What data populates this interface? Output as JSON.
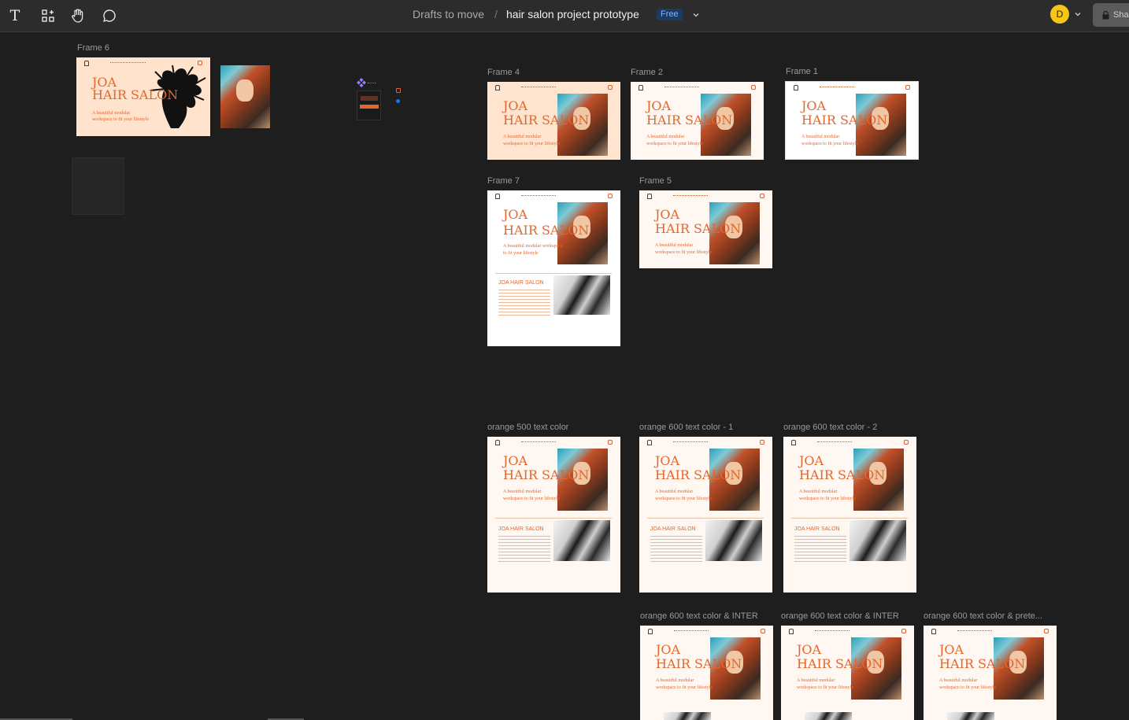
{
  "toolbar": {
    "tools": [
      {
        "name": "text-tool",
        "glyph": "T"
      },
      {
        "name": "components-tool",
        "glyph": "⊹"
      },
      {
        "name": "hand-tool",
        "glyph": "✋"
      },
      {
        "name": "comment-tool",
        "glyph": "💬"
      }
    ],
    "breadcrumb_parent": "Drafts to move",
    "breadcrumb_sep": "/",
    "file_name": "hair salon project prototype",
    "plan_badge": "Free",
    "avatar_initial": "D",
    "share_label": "Share"
  },
  "colors": {
    "accent_orange": "#e3672d",
    "canvas_bg": "#1e1e1e",
    "toolbar_bg": "#2c2c2c",
    "badge_blue": "#1d3a63",
    "avatar_yellow": "#f5c518"
  },
  "frames": [
    {
      "label": "Frame 6",
      "title1": "JOA",
      "title2": "HAIR SALON",
      "sub1": "A beautiful modular",
      "sub2": "workspace to fit your lifestyle"
    },
    {
      "label": "Frame 4",
      "title1": "JOA",
      "title2": "HAIR SALON",
      "sub1": "A beautiful modular",
      "sub2": "workspace to fit your lifestyle"
    },
    {
      "label": "Frame 2",
      "title1": "JOA",
      "title2": "HAIR SALON",
      "sub1": "A beautiful modular",
      "sub2": "workspace to fit your lifestyle"
    },
    {
      "label": "Frame 1",
      "title1": "JOA",
      "title2": "HAIR SALON",
      "sub1": "A beautiful modular",
      "sub2": "workspace to fit your lifestyle"
    },
    {
      "label": "Frame 7",
      "title1": "JOA",
      "title2": "HAIR SALON",
      "sub1": "A beautiful modular workspace",
      "sub2": "to fit your lifestyle",
      "section": "JOA HAIR SALON"
    },
    {
      "label": "Frame 5",
      "title1": "JOA",
      "title2": "HAIR SALON",
      "sub1": "A beautiful modular",
      "sub2": "workspace to fit your lifestyle"
    },
    {
      "label": "orange 500 text color",
      "title1": "JOA",
      "title2": "HAIR SALON",
      "sub1": "A beautiful modular",
      "sub2": "workspace to fit your lifestyle",
      "section": "JOA HAIR SALON"
    },
    {
      "label": "orange 600 text color - 1",
      "title1": "JOA",
      "title2": "HAIR SALON",
      "sub1": "A beautiful modular",
      "sub2": "workspace to fit your lifestyle",
      "section": "JOA HAIR SALON"
    },
    {
      "label": "orange 600 text color - 2",
      "title1": "JOA",
      "title2": "HAIR SALON",
      "sub1": "A beautiful modular",
      "sub2": "workspace to fit your lifestyle",
      "section": "JOA HAIR SALON"
    },
    {
      "label": "orange 600 text color & INTER",
      "title1": "JOA",
      "title2": "HAIR SALON",
      "sub1": "A beautiful modular",
      "sub2": "workspace to fit your lifestyle"
    },
    {
      "label": "orange 600 text color & INTER",
      "title1": "JOA",
      "title2": "HAIR SALON",
      "sub1": "A beautiful modular",
      "sub2": "workspace to fit your lifestyle"
    },
    {
      "label": "orange 600 text color & prete...",
      "title1": "JOA",
      "title2": "HAIR SALON",
      "sub1": "A beautiful modular",
      "sub2": "workspace to fit your lifestyle"
    }
  ]
}
